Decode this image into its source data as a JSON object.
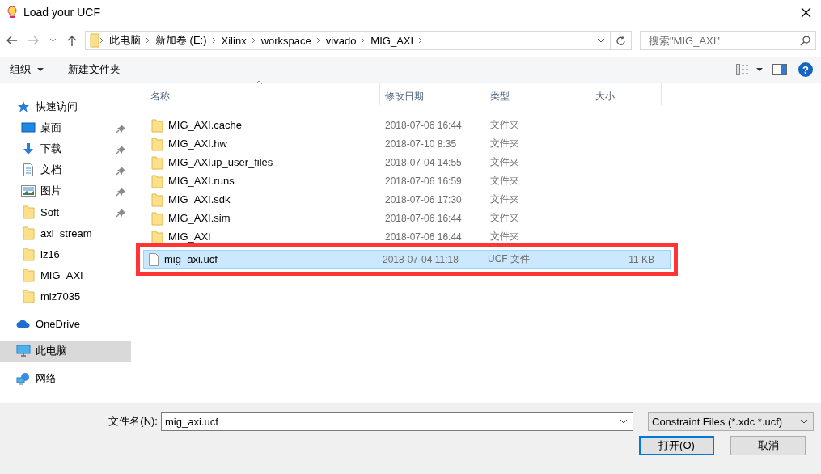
{
  "window": {
    "title": "Load your UCF"
  },
  "address": {
    "segments": [
      "此电脑",
      "新加卷 (E:)",
      "Xilinx",
      "workspace",
      "vivado",
      "MIG_AXI"
    ]
  },
  "search": {
    "placeholder": "搜索\"MIG_AXI\""
  },
  "toolbar": {
    "organize": "组织",
    "new_folder": "新建文件夹",
    "help": "?"
  },
  "sidebar": {
    "items": [
      {
        "label": "快速访问",
        "kind": "star",
        "pinned": false,
        "selected": false,
        "children": [
          {
            "label": "桌面",
            "kind": "desktop",
            "pinned": true,
            "selected": false
          },
          {
            "label": "下载",
            "kind": "download",
            "pinned": true,
            "selected": false
          },
          {
            "label": "文档",
            "kind": "document",
            "pinned": true,
            "selected": false
          },
          {
            "label": "图片",
            "kind": "picture",
            "pinned": true,
            "selected": false
          },
          {
            "label": "Soft",
            "kind": "folder",
            "pinned": true,
            "selected": false
          },
          {
            "label": "axi_stream",
            "kind": "folder",
            "pinned": false,
            "selected": false
          },
          {
            "label": "lz16",
            "kind": "folder",
            "pinned": false,
            "selected": false
          },
          {
            "label": "MIG_AXI",
            "kind": "folder",
            "pinned": false,
            "selected": false
          },
          {
            "label": "miz7035",
            "kind": "folder",
            "pinned": false,
            "selected": false
          }
        ]
      },
      {
        "label": "OneDrive",
        "kind": "cloud",
        "pinned": false,
        "selected": false
      },
      {
        "label": "此电脑",
        "kind": "computer",
        "pinned": false,
        "selected": true
      },
      {
        "label": "网络",
        "kind": "network",
        "pinned": false,
        "selected": false
      }
    ]
  },
  "table": {
    "columns": [
      {
        "label": "名称",
        "sorted": true
      },
      {
        "label": "修改日期",
        "sorted": false
      },
      {
        "label": "类型",
        "sorted": false
      },
      {
        "label": "大小",
        "sorted": false
      }
    ],
    "rows": [
      {
        "kind": "folder",
        "name": "MIG_AXI.cache",
        "date": "2018-07-06 16:44",
        "type": "文件夹",
        "selected": false,
        "outlined": false
      },
      {
        "kind": "folder",
        "name": "MIG_AXI.hw",
        "date": "2018-07-10 8:35",
        "type": "文件夹",
        "selected": false,
        "outlined": false
      },
      {
        "kind": "folder",
        "name": "MIG_AXI.ip_user_files",
        "date": "2018-07-04 14:55",
        "type": "文件夹",
        "selected": false,
        "outlined": false
      },
      {
        "kind": "folder",
        "name": "MIG_AXI.runs",
        "date": "2018-07-06 16:59",
        "type": "文件夹",
        "selected": false,
        "outlined": false
      },
      {
        "kind": "folder",
        "name": "MIG_AXI.sdk",
        "date": "2018-07-06 17:30",
        "type": "文件夹",
        "selected": false,
        "outlined": false
      },
      {
        "kind": "folder",
        "name": "MIG_AXI.sim",
        "date": "2018-07-06 16:44",
        "type": "文件夹",
        "selected": false,
        "outlined": false
      },
      {
        "kind": "folder",
        "name": "MIG_AXI",
        "date": "2018-07-06 16:44",
        "type": "文件夹",
        "selected": false,
        "outlined": false
      },
      {
        "kind": "file",
        "name": "mig_axi.ucf",
        "date": "2018-07-04 11:18",
        "type": "UCF 文件",
        "size": "11 KB",
        "selected": true,
        "outlined": true
      }
    ]
  },
  "footer": {
    "filename_label": "文件名(N):",
    "filename": "mig_axi.ucf",
    "filter": "Constraint Files (*.xdc *.ucf)",
    "buttons": [
      {
        "label": "打开(O)",
        "default": true
      },
      {
        "label": "取消",
        "default": false
      }
    ]
  }
}
